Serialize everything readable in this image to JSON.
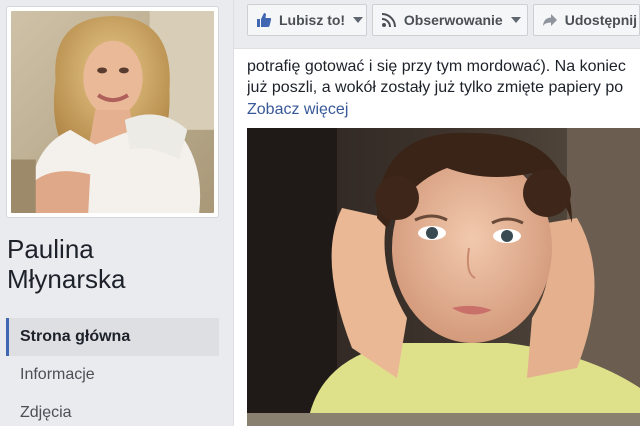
{
  "page": {
    "name_line1": "Paulina",
    "name_line2": "Młynarska"
  },
  "nav": {
    "items": [
      {
        "label": "Strona główna",
        "active": true
      },
      {
        "label": "Informacje",
        "active": false
      },
      {
        "label": "Zdjęcia",
        "active": false
      }
    ]
  },
  "actions": {
    "like_label": "Lubisz to!",
    "follow_label": "Obserwowanie",
    "share_label": "Udostępnij"
  },
  "post": {
    "line1": "potrafię gotować i się przy tym mordować). Na koniec",
    "line2": "już poszli, a wokół zostały już tylko zmięte papiery po",
    "see_more": "Zobacz więcej"
  },
  "colors": {
    "accent": "#4267b2",
    "link": "#385898",
    "text": "#1d2129",
    "background": "#e9ebee"
  },
  "icons": {
    "like": "thumbs-up-icon",
    "follow": "rss-icon",
    "share": "share-arrow-icon"
  }
}
